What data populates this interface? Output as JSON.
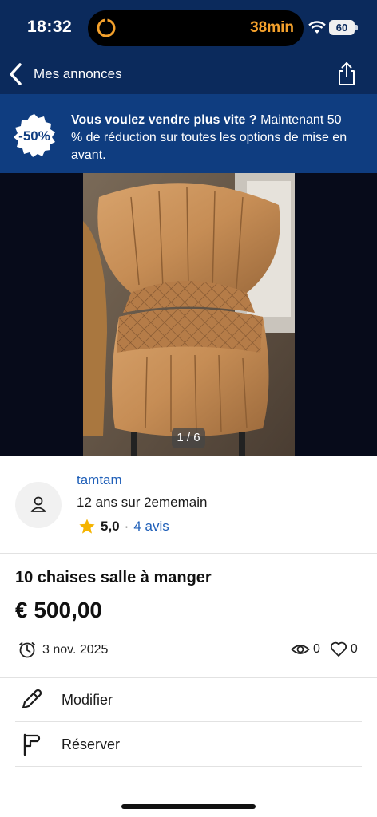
{
  "status_bar": {
    "time": "18:32",
    "timer": "38min",
    "battery": "60"
  },
  "nav": {
    "back_label": "Mes annonces"
  },
  "promo": {
    "badge": "-50%",
    "bold_text": "Vous voulez vendre plus vite ?",
    "text": " Maintenant 50 % de réduction sur toutes les options de mise en avant."
  },
  "gallery": {
    "counter": "1 / 6"
  },
  "seller": {
    "name": "tamtam",
    "since": "12 ans sur 2ememain",
    "rating": "5,0",
    "separator": "·",
    "reviews": "4 avis"
  },
  "listing": {
    "title": "10 chaises salle à manger",
    "price": "€ 500,00",
    "date": "3 nov. 2025",
    "views": "0",
    "favorites": "0"
  },
  "actions": [
    {
      "label": "Modifier",
      "icon": "pencil-icon"
    },
    {
      "label": "Réserver",
      "icon": "flag-icon"
    }
  ],
  "colors": {
    "header": "#0b2a5c",
    "promo": "#0f3d80",
    "link": "#1f5fb8",
    "timer": "#f4a12c",
    "star": "#f5b400"
  }
}
